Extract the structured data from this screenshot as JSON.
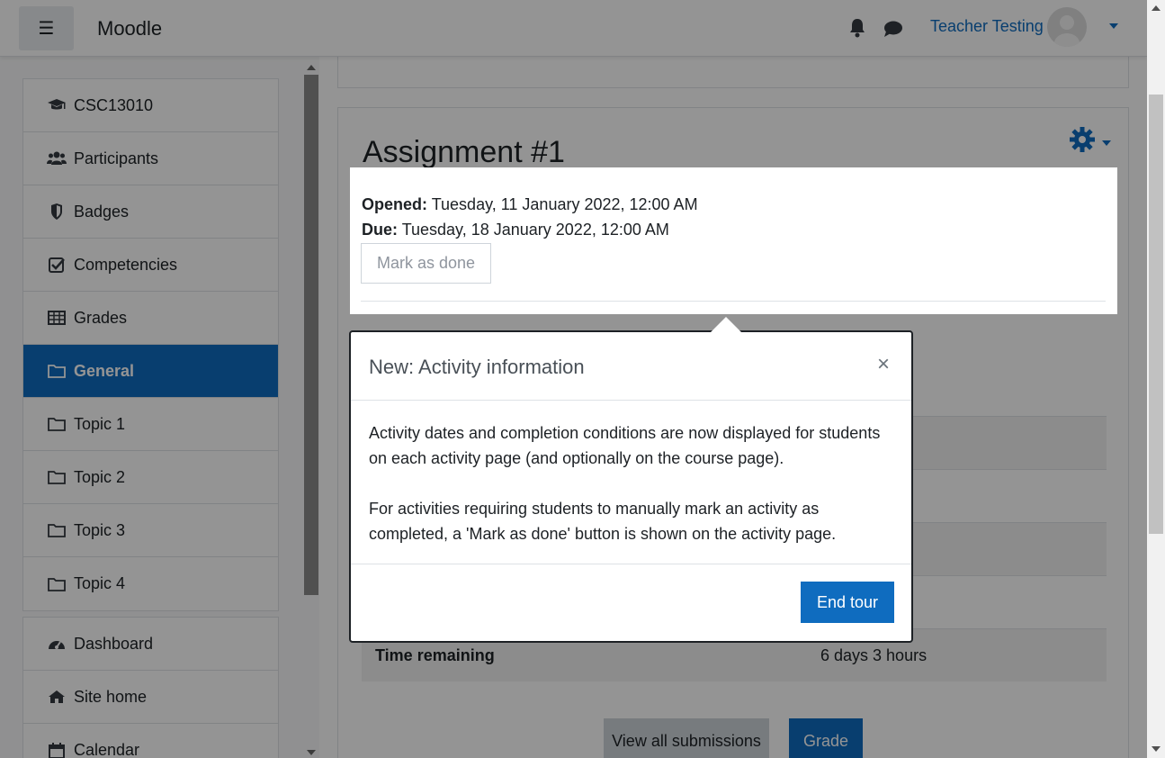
{
  "navbar": {
    "brand": "Moodle",
    "user_name": "Teacher Testing"
  },
  "drawer": {
    "course_items": [
      {
        "label": "CSC13010",
        "icon": "graduation-cap-icon"
      },
      {
        "label": "Participants",
        "icon": "users-icon"
      },
      {
        "label": "Badges",
        "icon": "shield-icon"
      },
      {
        "label": "Competencies",
        "icon": "check-square-icon"
      },
      {
        "label": "Grades",
        "icon": "table-icon"
      },
      {
        "label": "General",
        "icon": "folder-icon",
        "active": true
      },
      {
        "label": "Topic 1",
        "icon": "folder-icon"
      },
      {
        "label": "Topic 2",
        "icon": "folder-icon"
      },
      {
        "label": "Topic 3",
        "icon": "folder-icon"
      },
      {
        "label": "Topic 4",
        "icon": "folder-icon"
      }
    ],
    "site_items": [
      {
        "label": "Dashboard",
        "icon": "dashboard-icon"
      },
      {
        "label": "Site home",
        "icon": "home-icon"
      },
      {
        "label": "Calendar",
        "icon": "calendar-icon"
      }
    ]
  },
  "activity": {
    "title": "Assignment #1",
    "opened_label": "Opened:",
    "opened_value": "Tuesday, 11 January 2022, 12:00 AM",
    "due_label": "Due:",
    "due_value": "Tuesday, 18 January 2022, 12:00 AM",
    "mark_done_label": "Mark as done"
  },
  "status": {
    "time_remaining_label": "Time remaining",
    "time_remaining_value": "6 days 3 hours"
  },
  "actions": {
    "view_all_label": "View all submissions",
    "grade_label": "Grade"
  },
  "tour": {
    "title": "New: Activity information",
    "close_symbol": "×",
    "paragraph_1": "Activity dates and completion conditions are now displayed for students on each activity page (and optionally on the course page).",
    "paragraph_2": "For activities requiring students to manually mark an activity as completed, a 'Mark as done' button is shown on the activity page.",
    "end_label": "End tour"
  },
  "colors": {
    "primary": "#0f6cbf",
    "backdrop": "rgba(0,0,0,0.42)"
  }
}
